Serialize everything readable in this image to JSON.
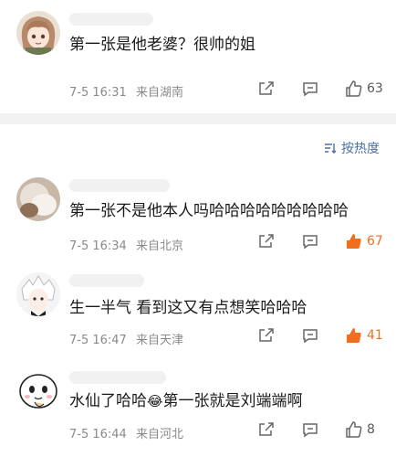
{
  "comments_top": [
    {
      "text": "第一张是他老婆？很帅的姐",
      "date": "7-5 16:31",
      "location": "来自湖南",
      "likes": "63",
      "likes_hot": false
    }
  ],
  "sort": {
    "label": "按热度"
  },
  "comments": [
    {
      "text": "第一张不是他本人吗哈哈哈哈哈哈哈哈哈",
      "date": "7-5 16:34",
      "location": "来自北京",
      "likes": "67",
      "likes_hot": true
    },
    {
      "text": "生一半气 看到这又有点想笑哈哈哈",
      "date": "7-5 16:47",
      "location": "来自天津",
      "likes": "41",
      "likes_hot": true
    },
    {
      "text_before": "水仙了哈哈",
      "text_after": "第一张就是刘端端啊",
      "emoji": "😂",
      "date": "7-5 16:44",
      "location": "来自河北",
      "likes": "8",
      "likes_hot": false
    }
  ],
  "colors": {
    "hot": "#f26e1f",
    "link": "#4a6fa5",
    "meta": "#8a8a8a"
  }
}
